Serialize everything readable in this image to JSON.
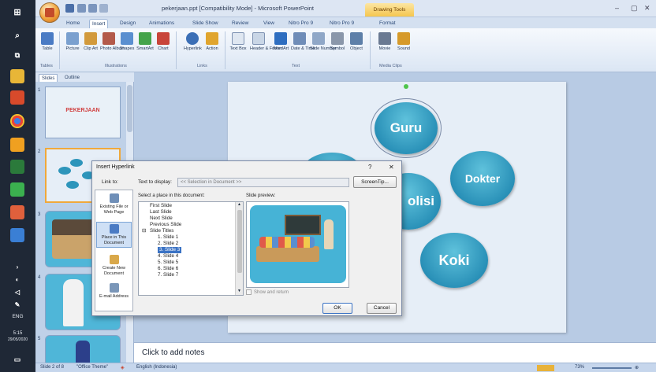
{
  "window": {
    "title": "pekerjaan.ppt [Compatibility Mode] - Microsoft PowerPoint",
    "contextual_tab": "Drawing Tools",
    "controls": [
      "–",
      "▢",
      "✕"
    ]
  },
  "ribbon": {
    "tabs": [
      "Home",
      "Insert",
      "Design",
      "Animations",
      "Slide Show",
      "Review",
      "View",
      "Nitro Pro 9",
      "Nitro Pro 9",
      "Format"
    ],
    "active_tab": "Insert",
    "buttons": [
      {
        "label": "Table",
        "color": "#4a7bc4"
      },
      {
        "label": "Picture",
        "color": "#7aa0cf"
      },
      {
        "label": "Clip Art",
        "color": "#d29a3c"
      },
      {
        "label": "Photo Album",
        "color": "#b35a4a"
      },
      {
        "label": "Shapes",
        "color": "#5a8fd0"
      },
      {
        "label": "SmartArt",
        "color": "#44a34a"
      },
      {
        "label": "Chart",
        "color": "#c8453a"
      },
      {
        "label": "Hyperlink",
        "color": "#3b6fb6"
      },
      {
        "label": "Action",
        "color": "#e0a52e"
      },
      {
        "label": "Text Box",
        "color": "#dfe7f1"
      },
      {
        "label": "Header & Footer",
        "color": "#c9d6e6"
      },
      {
        "label": "WordArt",
        "color": "#2e6ec0"
      },
      {
        "label": "Date & Time",
        "color": "#6f8db8"
      },
      {
        "label": "Slide Number",
        "color": "#8fa7c7"
      },
      {
        "label": "Symbol",
        "color": "#8a97aa"
      },
      {
        "label": "Object",
        "color": "#5d7fa8"
      },
      {
        "label": "Movie",
        "color": "#6a7a92"
      },
      {
        "label": "Sound",
        "color": "#d69a2a"
      }
    ],
    "groups": [
      "Tables",
      "Illustrations",
      "Links",
      "Text",
      "Media Clips"
    ]
  },
  "slides_pane": {
    "tabs": [
      "Slides",
      "Outline"
    ],
    "thumbnails": [
      {
        "num": "1",
        "text": "PEKERJAAN"
      },
      {
        "num": "2",
        "text": ""
      },
      {
        "num": "3",
        "text": ""
      },
      {
        "num": "4",
        "text": ""
      },
      {
        "num": "5",
        "text": ""
      }
    ]
  },
  "slide": {
    "bubbles": [
      {
        "label": "Guru"
      },
      {
        "label": "Dokter"
      },
      {
        "label": "olisi"
      },
      {
        "label": "Koki"
      },
      {
        "label": ""
      }
    ]
  },
  "notes": {
    "placeholder": "Click to add notes"
  },
  "statusbar": {
    "slide_info": "Slide 2 of 8",
    "theme": "\"Office Theme\"",
    "language": "English (Indonesia)",
    "zoom": "73%"
  },
  "dialog": {
    "title": "Insert Hyperlink",
    "help": "?",
    "close": "✕",
    "link_to_label": "Link to:",
    "link_to_options": [
      {
        "label": "Existing File or Web Page",
        "color": "#6f8fb8"
      },
      {
        "label": "Place in This Document",
        "color": "#4a7bc4",
        "selected": true
      },
      {
        "label": "Create New Document",
        "color": "#d9a84a"
      },
      {
        "label": "E-mail Address",
        "color": "#7a96b8"
      }
    ],
    "text_to_display_label": "Text to display:",
    "text_to_display_value": "<< Selection in Document >>",
    "screentip_label": "ScreenTip...",
    "select_place_label": "Select a place in this document:",
    "tree": [
      {
        "label": "First Slide",
        "indent": 0
      },
      {
        "label": "Last Slide",
        "indent": 0
      },
      {
        "label": "Next Slide",
        "indent": 0
      },
      {
        "label": "Previous Slide",
        "indent": 0
      },
      {
        "label": "Slide Titles",
        "indent": 0
      },
      {
        "label": "1. Slide 1",
        "indent": 1
      },
      {
        "label": "2. Slide 2",
        "indent": 1
      },
      {
        "label": "3. Slide 3",
        "indent": 1,
        "selected": true
      },
      {
        "label": "4. Slide 4",
        "indent": 1
      },
      {
        "label": "5. Slide 5",
        "indent": 1
      },
      {
        "label": "6. Slide 6",
        "indent": 1
      },
      {
        "label": "7. Slide 7",
        "indent": 1
      }
    ],
    "slide_preview_label": "Slide preview:",
    "show_and_return_label": "Show and return",
    "ok_label": "OK",
    "cancel_label": "Cancel"
  },
  "taskbar": {
    "lang": "ENG",
    "time": "5:15",
    "date": "29/05/2020"
  }
}
